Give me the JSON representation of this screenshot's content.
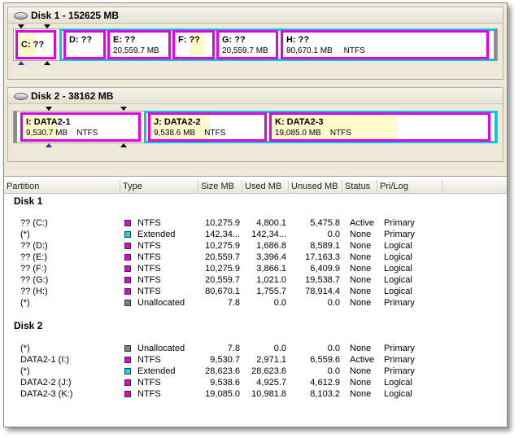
{
  "colors": {
    "primary_border": "#e000e0",
    "extended_border": "#00c8e0",
    "used_fill": "#fffacc",
    "ntfs_swatch": "#e000e0",
    "extended_swatch": "#00e0f0",
    "unallocated_swatch": "#808080"
  },
  "disk1": {
    "title": "Disk 1 - 152625 MB",
    "partitions": {
      "c": {
        "label": "C:  ??"
      },
      "d": {
        "label": "D:  ??"
      },
      "e": {
        "label": "E:  ??",
        "size": "20,559.7 MB"
      },
      "f": {
        "label": "F:  ??"
      },
      "g": {
        "label": "G:  ??",
        "size": "20,559.7 MB"
      },
      "h": {
        "label": "H:  ??",
        "size": "80,670.1 MB",
        "fs": "NTFS"
      }
    }
  },
  "disk2": {
    "title": "Disk 2 - 38162 MB",
    "partitions": {
      "i": {
        "label": "I:  DATA2-1",
        "size": "9,530.7 MB",
        "fs": "NTFS",
        "used_fraction": 0.31
      },
      "j": {
        "label": "J:  DATA2-2",
        "size": "9,538.6 MB",
        "fs": "NTFS",
        "used_fraction": 0.52
      },
      "k": {
        "label": "K:  DATA2-3",
        "size": "19,085.0 MB",
        "fs": "NTFS",
        "used_fraction": 0.58
      }
    }
  },
  "list": {
    "columns": {
      "partition": "Partition",
      "type": "Type",
      "size": "Size MB",
      "used": "Used MB",
      "unused": "Unused MB",
      "status": "Status",
      "prilog": "Pri/Log"
    },
    "groups": [
      {
        "title": "Disk 1",
        "rows": [
          {
            "partition": "?? (C:)",
            "type": "NTFS",
            "swatch": "#e000e0",
            "size": "10,275.9",
            "used": "4,800.1",
            "unused": "5,475.8",
            "status": "Active",
            "prilog": "Primary"
          },
          {
            "partition": "(*)",
            "type": "Extended",
            "swatch": "#00e0f0",
            "size": "142,34...",
            "used": "142,34...",
            "unused": "0.0",
            "status": "None",
            "prilog": "Primary"
          },
          {
            "partition": "?? (D:)",
            "type": "NTFS",
            "swatch": "#e000e0",
            "size": "10,275.9",
            "used": "1,686.8",
            "unused": "8,589.1",
            "status": "None",
            "prilog": "Logical"
          },
          {
            "partition": "?? (E:)",
            "type": "NTFS",
            "swatch": "#e000e0",
            "size": "20,559.7",
            "used": "3,396.4",
            "unused": "17,163.3",
            "status": "None",
            "prilog": "Logical"
          },
          {
            "partition": "?? (F:)",
            "type": "NTFS",
            "swatch": "#e000e0",
            "size": "10,275.9",
            "used": "3,866.1",
            "unused": "6,409.9",
            "status": "None",
            "prilog": "Logical"
          },
          {
            "partition": "?? (G:)",
            "type": "NTFS",
            "swatch": "#e000e0",
            "size": "20,559.7",
            "used": "1,021.0",
            "unused": "19,538.7",
            "status": "None",
            "prilog": "Logical"
          },
          {
            "partition": "?? (H:)",
            "type": "NTFS",
            "swatch": "#e000e0",
            "size": "80,670.1",
            "used": "1,755.7",
            "unused": "78,914.4",
            "status": "None",
            "prilog": "Logical"
          },
          {
            "partition": "(*)",
            "type": "Unallocated",
            "swatch": "#808080",
            "size": "7.8",
            "used": "0.0",
            "unused": "0.0",
            "status": "None",
            "prilog": "Primary"
          }
        ]
      },
      {
        "title": "Disk 2",
        "rows": [
          {
            "partition": "(*)",
            "type": "Unallocated",
            "swatch": "#808080",
            "size": "7.8",
            "used": "0.0",
            "unused": "0.0",
            "status": "None",
            "prilog": "Primary"
          },
          {
            "partition": "DATA2-1 (I:)",
            "type": "NTFS",
            "swatch": "#e000e0",
            "size": "9,530.7",
            "used": "2,971.1",
            "unused": "6,559.6",
            "status": "Active",
            "prilog": "Primary"
          },
          {
            "partition": "(*)",
            "type": "Extended",
            "swatch": "#00e0f0",
            "size": "28,623.6",
            "used": "28,623.6",
            "unused": "0.0",
            "status": "None",
            "prilog": "Primary"
          },
          {
            "partition": "DATA2-2 (J:)",
            "type": "NTFS",
            "swatch": "#e000e0",
            "size": "9,538.6",
            "used": "4,925.7",
            "unused": "4,612.9",
            "status": "None",
            "prilog": "Logical"
          },
          {
            "partition": "DATA2-3 (K:)",
            "type": "NTFS",
            "swatch": "#e000e0",
            "size": "19,085.0",
            "used": "10,981.8",
            "unused": "8,103.2",
            "status": "None",
            "prilog": "Logical"
          }
        ]
      }
    ]
  }
}
